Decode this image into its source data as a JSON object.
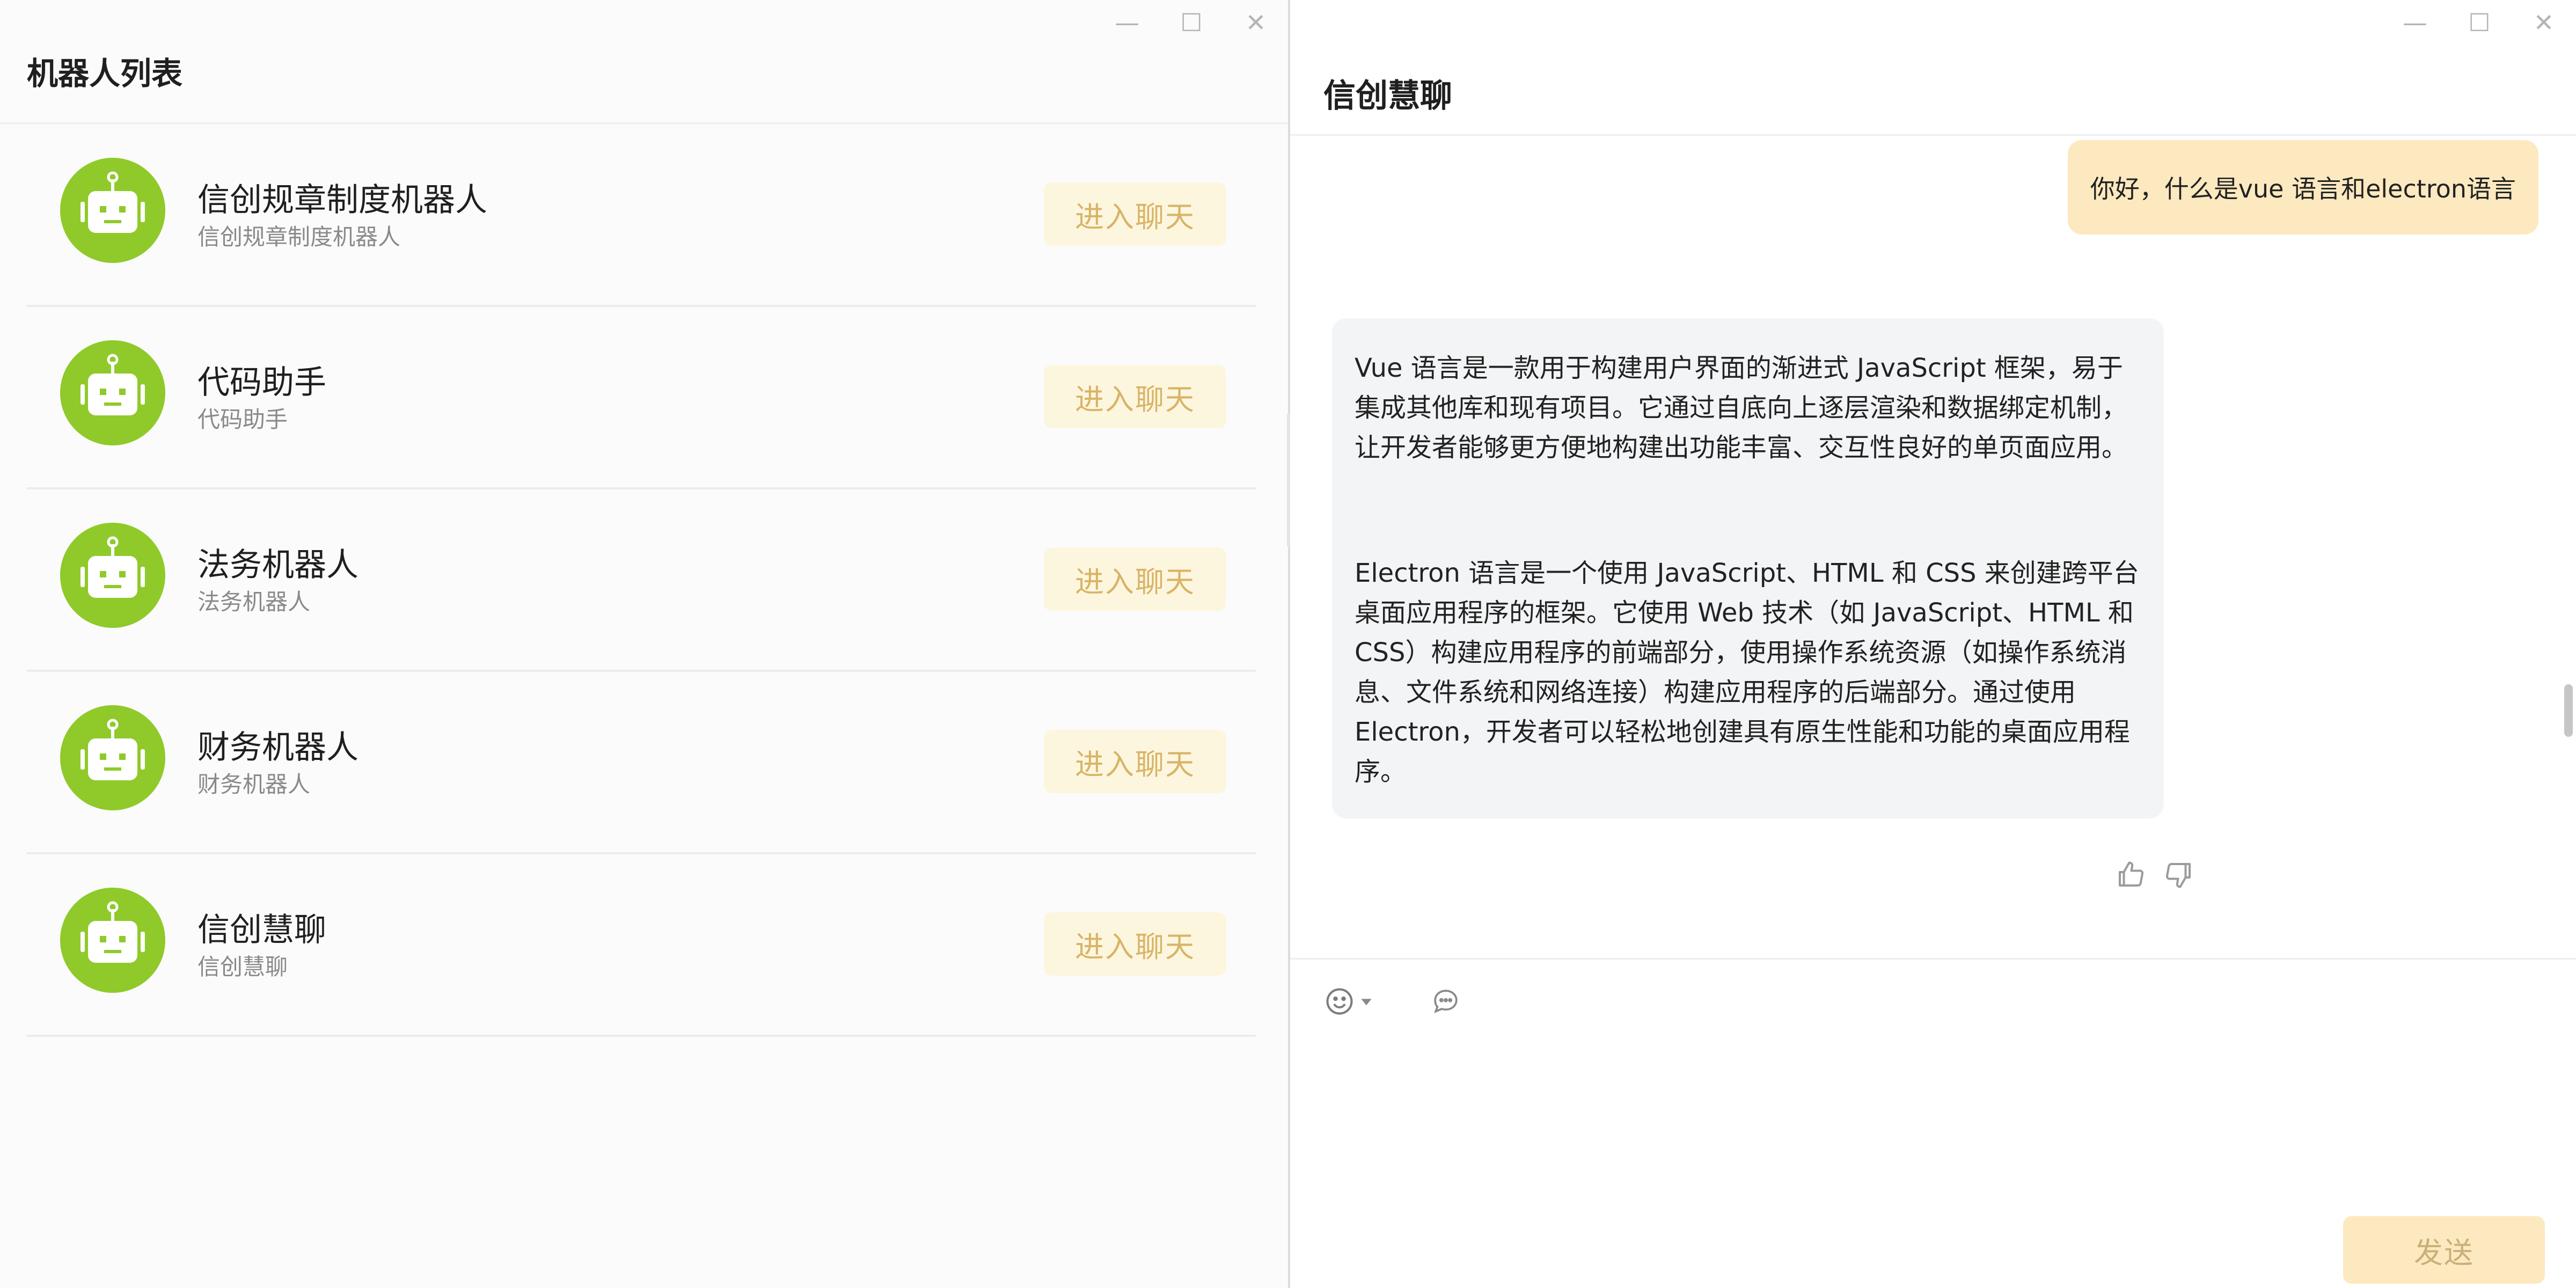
{
  "window_controls": {
    "minimize": "—",
    "maximize": "☐",
    "close": "✕"
  },
  "robot_list": {
    "title": "机器人列表",
    "enter_label": "进入聊天",
    "items": [
      {
        "name": "信创规章制度机器人",
        "desc": "信创规章制度机器人"
      },
      {
        "name": "代码助手",
        "desc": "代码助手"
      },
      {
        "name": "法务机器人",
        "desc": "法务机器人"
      },
      {
        "name": "财务机器人",
        "desc": "财务机器人"
      },
      {
        "name": "信创慧聊",
        "desc": "信创慧聊"
      }
    ]
  },
  "chat": {
    "title": "信创慧聊",
    "user_message": "你好，什么是vue 语言和electron语言",
    "bot_paragraph_1": "Vue 语言是一款用于构建用户界面的渐进式 JavaScript 框架，易于集成其他库和现有项目。它通过自底向上逐层渲染和数据绑定机制，让开发者能够更方便地构建出功能丰富、交互性良好的单页面应用。",
    "bot_paragraph_2": "Electron 语言是一个使用 JavaScript、HTML 和 CSS 来创建跨平台桌面应用程序的框架。它使用 Web 技术（如 JavaScript、HTML 和 CSS）构建应用程序的前端部分，使用操作系统资源（如操作系统消息、文件系统和网络连接）构建应用程序的后端部分。通过使用 Electron，开发者可以轻松地创建具有原生性能和功能的桌面应用程序。",
    "input_value": "",
    "send_label": "发送"
  },
  "colors": {
    "avatar_green": "#8fca2a",
    "enter_button_bg": "#fdf6df",
    "enter_button_text": "#d8b466",
    "user_bubble_bg": "#fde9bf",
    "bot_bubble_bg": "#f3f4f6",
    "send_button_bg": "#fde9bf"
  },
  "icons": {
    "avatar": "robot-icon",
    "like": "thumbs-up-icon",
    "dislike": "thumbs-down-icon",
    "emoji": "smiley-icon",
    "quick_reply": "chat-bubble-icon"
  }
}
